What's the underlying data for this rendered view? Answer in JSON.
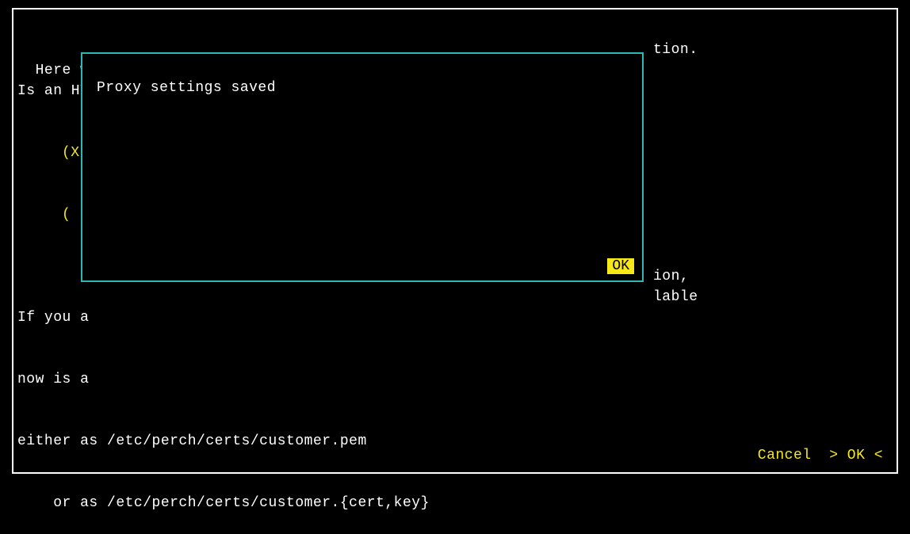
{
  "bg": {
    "line1_left": "Here we",
    "line1_right": "tion.",
    "line2_left": "Is an HT",
    "radio1": "(X)",
    "radio2": "( )",
    "mid1_left": "If you a",
    "mid1_right": "ion,",
    "mid2_left": "now is a",
    "mid2_right": "lable",
    "mid3": "either as /etc/perch/certs/customer.pem",
    "mid4": "    or as /etc/perch/certs/customer.{cert,key}"
  },
  "dialog": {
    "message": "Proxy settings saved",
    "ok": "OK"
  },
  "footer": {
    "cancel": "Cancel",
    "ok": "> OK <"
  }
}
